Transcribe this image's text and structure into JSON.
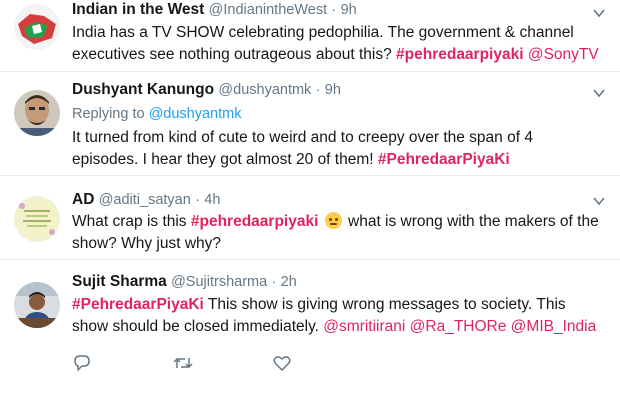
{
  "tweets": [
    {
      "name": "Indian in the West",
      "handle": "@IndianintheWest",
      "sep": "·",
      "time": "9h",
      "segments": [
        {
          "type": "text",
          "value": "India has a TV SHOW celebrating pedophilia. The government & channel executives see nothing outrageous about this? "
        },
        {
          "type": "hash",
          "value": "#pehredaarpiyaki"
        },
        {
          "type": "text",
          "value": " "
        },
        {
          "type": "mention",
          "value": "@SonyTV"
        }
      ]
    },
    {
      "name": "Dushyant Kanungo",
      "handle": "@dushyantmk",
      "sep": "·",
      "time": "9h",
      "reply_prefix": "Replying to ",
      "reply_to": "@dushyantmk",
      "segments": [
        {
          "type": "text",
          "value": "It turned from kind of cute to weird and to creepy over the span of 4 episodes. I hear they got almost 20 of them! "
        },
        {
          "type": "hash",
          "value": "#PehredaarPiyaKi"
        }
      ]
    },
    {
      "name": "AD",
      "handle": "@aditi_satyan",
      "sep": "·",
      "time": "4h",
      "segments": [
        {
          "type": "text",
          "value": "What crap is this "
        },
        {
          "type": "hash",
          "value": "#pehredaarpiyaki"
        },
        {
          "type": "text",
          "value": " "
        },
        {
          "type": "emoji",
          "value": "slightly-smiling-face"
        },
        {
          "type": "text",
          "value": " what is wrong with the makers of the show? Why just why?"
        }
      ]
    },
    {
      "name": "Sujit Sharma",
      "handle": "@Sujitrsharma",
      "sep": "·",
      "time": "2h",
      "segments": [
        {
          "type": "hash",
          "value": "#PehredaarPiyaKi"
        },
        {
          "type": "text",
          "value": " This show is giving wrong messages to society. This show should be closed immediately. "
        },
        {
          "type": "mention",
          "value": "@smritiirani"
        },
        {
          "type": "text",
          "value": " "
        },
        {
          "type": "mention",
          "value": "@Ra_THORe"
        },
        {
          "type": "text",
          "value": " "
        },
        {
          "type": "mention",
          "value": "@MIB_India"
        }
      ]
    }
  ],
  "actions": [
    {
      "icon": "reply-icon"
    },
    {
      "icon": "retweet-icon"
    },
    {
      "icon": "like-icon"
    }
  ],
  "colors": {
    "hashtag": "#e0245e",
    "reply_link": "#1da1f2",
    "meta": "#657786",
    "divider": "#e6ecf0"
  }
}
